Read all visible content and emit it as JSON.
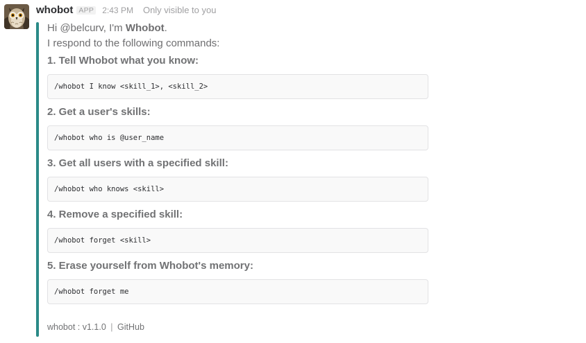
{
  "message": {
    "sender": "whobot",
    "app_badge": "APP",
    "timestamp": "2:43 PM",
    "visibility": "Only visible to you",
    "bar_color": "#2a8a87",
    "avatar_icon": "owl-avatar-icon"
  },
  "intro": {
    "greeting_prefix": "Hi @belcurv, I'm ",
    "bot_name": "Whobot",
    "greeting_suffix": ".",
    "subtitle": "I respond to the following commands:"
  },
  "commands": [
    {
      "heading": "1. Tell Whobot what you know:",
      "code": "/whobot I know <skill_1>, <skill_2>"
    },
    {
      "heading": "2. Get a user's skills:",
      "code": "/whobot who is @user_name"
    },
    {
      "heading": "3. Get all users with a specified skill:",
      "code": "/whobot who knows <skill>"
    },
    {
      "heading": "4. Remove a specified skill:",
      "code": "/whobot forget <skill>"
    },
    {
      "heading": "5. Erase yourself from Whobot's memory:",
      "code": "/whobot forget me"
    }
  ],
  "footer": {
    "version": "whobot : v1.1.0",
    "separator": "|",
    "link": "GitHub"
  }
}
